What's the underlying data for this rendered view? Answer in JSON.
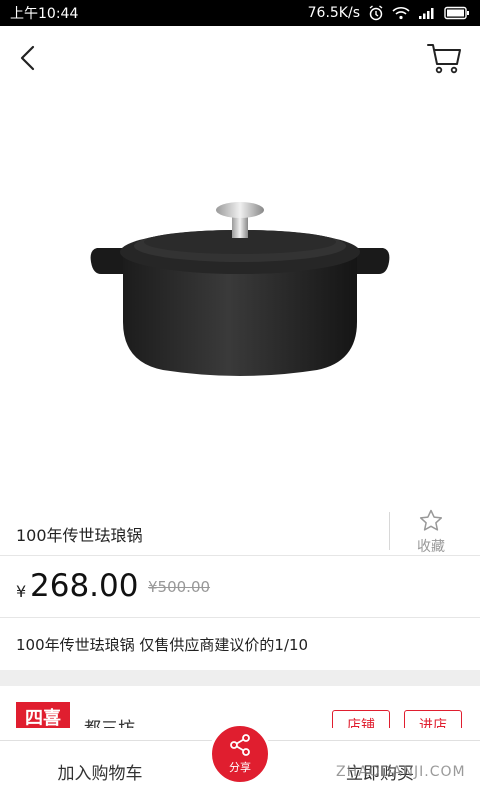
{
  "status_bar": {
    "time": "上午10:44",
    "network_speed": "76.5K/s"
  },
  "header": {
    "back_icon": "chevron-left-icon",
    "cart_icon": "cart-icon"
  },
  "product": {
    "image": "cast-iron-pot",
    "title": "100年传世珐琅锅",
    "favorite_label": "收藏",
    "currency_symbol": "¥",
    "price": "268.00",
    "original_price": "¥500.00",
    "description": "100年传世珐琅锅 仅售供应商建议价的1/10"
  },
  "store": {
    "logo_text": "四喜",
    "name": "都三坊",
    "button_1": "店铺",
    "button_2": "进店"
  },
  "bottom_bar": {
    "add_to_cart": "加入购物车",
    "share_label": "分享",
    "buy_now": "立即购买"
  },
  "watermark": "ZHAODANJI.COM",
  "colors": {
    "accent": "#e01e2f",
    "text": "#222222",
    "muted": "#999999",
    "divider": "#eeeeee"
  }
}
